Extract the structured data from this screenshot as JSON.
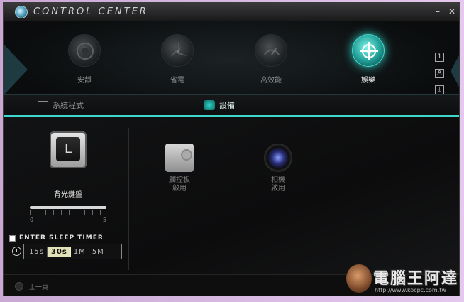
{
  "window": {
    "title": "Control Center",
    "minimize": "–",
    "close": "✕"
  },
  "modes": [
    {
      "label": "安靜",
      "icon": "speaker-icon",
      "active": false
    },
    {
      "label": "省電",
      "icon": "fan-icon",
      "active": false
    },
    {
      "label": "高效能",
      "icon": "gauge-icon",
      "active": false
    },
    {
      "label": "娛樂",
      "icon": "crosshair-icon",
      "active": true
    }
  ],
  "side_tools": [
    "1",
    "A",
    "⤓",
    "✈"
  ],
  "tabs": [
    {
      "label": "系統程式",
      "active": false
    },
    {
      "label": "設備",
      "active": true
    }
  ],
  "keyboard": {
    "key_letter": "L",
    "label": "背光鍵盤",
    "slider_min": "0",
    "slider_max": "5"
  },
  "sleep_timer": {
    "label": "Enter Sleep Timer",
    "checked": false,
    "options": [
      "15s",
      "30s",
      "1M",
      "5M"
    ],
    "selected": "30s"
  },
  "devices": [
    {
      "name": "觸控板",
      "status": "啟用",
      "icon": "touchpad-icon"
    },
    {
      "name": "相機",
      "status": "啟用",
      "icon": "camera-icon"
    }
  ],
  "footer": {
    "back_label": "上一頁"
  },
  "watermark": {
    "text": "電腦王阿達",
    "url": "http://www.kocpc.com.tw"
  },
  "colors": {
    "accent": "#3fd6cd",
    "background": "#0c0c0d",
    "frame": "#d7b8e1"
  }
}
